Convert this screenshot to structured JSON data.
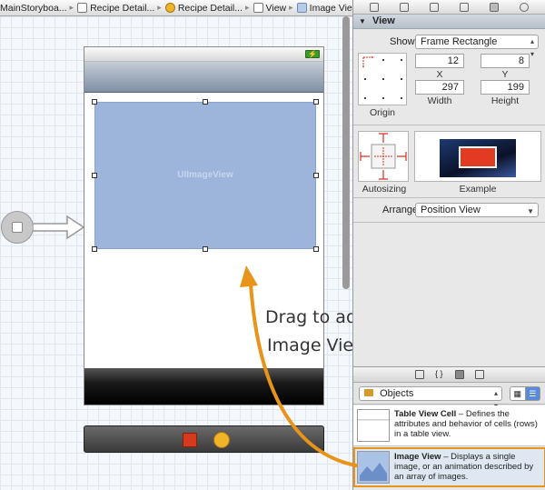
{
  "breadcrumb": {
    "items": [
      {
        "label": "MainStoryboa...",
        "icon": "storyboard-icon"
      },
      {
        "label": "Recipe Detail...",
        "icon": "scene-icon"
      },
      {
        "label": "Recipe Detail...",
        "icon": "view-controller-icon"
      },
      {
        "label": "View",
        "icon": "view-icon"
      },
      {
        "label": "Image View",
        "icon": "image-view-icon"
      }
    ]
  },
  "canvas": {
    "imageview_label": "UIImageView",
    "annotation_line1": "Drag to add",
    "annotation_line2": "Image View"
  },
  "inspector": {
    "section_title": "View",
    "show_label": "Show",
    "show_value": "Frame Rectangle",
    "x_value": "12",
    "y_value": "8",
    "x_label": "X",
    "y_label": "Y",
    "width_value": "297",
    "height_value": "199",
    "width_label": "Width",
    "height_label": "Height",
    "origin_label": "Origin",
    "autosizing_label": "Autosizing",
    "example_label": "Example",
    "arrange_label": "Arrange",
    "arrange_value": "Position View"
  },
  "library": {
    "selector_value": "Objects",
    "items": [
      {
        "title": "Table View Cell",
        "desc": " – Defines the attributes and behavior of cells (rows) in a table view."
      },
      {
        "title": "Image View",
        "desc": " – Displays a single image, or an animation described by an array of images."
      }
    ]
  },
  "colors": {
    "imageview_fill": "#9db5db",
    "arrow": "#e8931a",
    "autosizing_struts": "#d9301c"
  }
}
